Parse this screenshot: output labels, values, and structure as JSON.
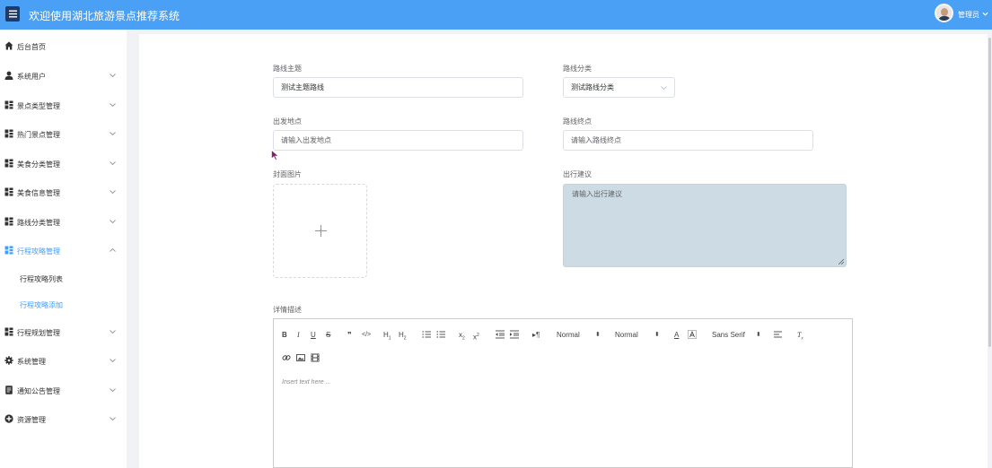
{
  "header": {
    "title": "欢迎使用湖北旅游景点推荐系统",
    "user_name": "管理员",
    "menu_icon": "hamburger-icon",
    "avatar_icon": "user-avatar"
  },
  "sidebar": {
    "items": [
      {
        "label": "后台首页",
        "icon": "home-icon"
      },
      {
        "label": "系统用户",
        "icon": "user-icon"
      },
      {
        "label": "景点类型管理",
        "icon": "grid-icon"
      },
      {
        "label": "热门景点管理",
        "icon": "grid-icon"
      },
      {
        "label": "美食分类管理",
        "icon": "grid-icon"
      },
      {
        "label": "美食信息管理",
        "icon": "grid-icon"
      },
      {
        "label": "路线分类管理",
        "icon": "grid-icon"
      },
      {
        "label": "行程攻略管理",
        "icon": "grid-icon"
      },
      {
        "label": "行程规划管理",
        "icon": "grid-icon"
      },
      {
        "label": "系统管理",
        "icon": "gear-icon"
      },
      {
        "label": "通知公告管理",
        "icon": "document-icon"
      },
      {
        "label": "资源管理",
        "icon": "plus-circle-icon"
      }
    ],
    "sub_items": [
      {
        "label": "行程攻略列表"
      },
      {
        "label": "行程攻略添加"
      }
    ],
    "active_color": "#409eff"
  },
  "form": {
    "route_theme_label": "路线主题",
    "route_theme_value": "测试主题路线",
    "route_category_label": "路线分类",
    "route_category_value": "测试路线分类",
    "start_label": "出发地点",
    "start_placeholder": "请输入出发地点",
    "end_label": "路线终点",
    "end_placeholder": "请输入路线终点",
    "cover_label": "封面图片",
    "advice_label": "出行建议",
    "advice_placeholder": "请输入出行建议",
    "detail_label": "详情描述"
  },
  "editor": {
    "placeholder": "Insert text here ...",
    "header_select": "Normal",
    "size_select": "Normal",
    "font_select": "Sans Serif",
    "tools": [
      "bold",
      "italic",
      "underline",
      "strike",
      "blockquote",
      "code-block",
      "header-1",
      "header-2",
      "ordered-list",
      "bullet-list",
      "subscript",
      "superscript",
      "indent-decrease",
      "indent-increase",
      "direction",
      "color",
      "background",
      "align",
      "clean",
      "link",
      "image",
      "video"
    ]
  },
  "colors": {
    "topbar": "#4aa0f5",
    "accent": "#409eff",
    "textarea_bg": "#cddbe4"
  }
}
